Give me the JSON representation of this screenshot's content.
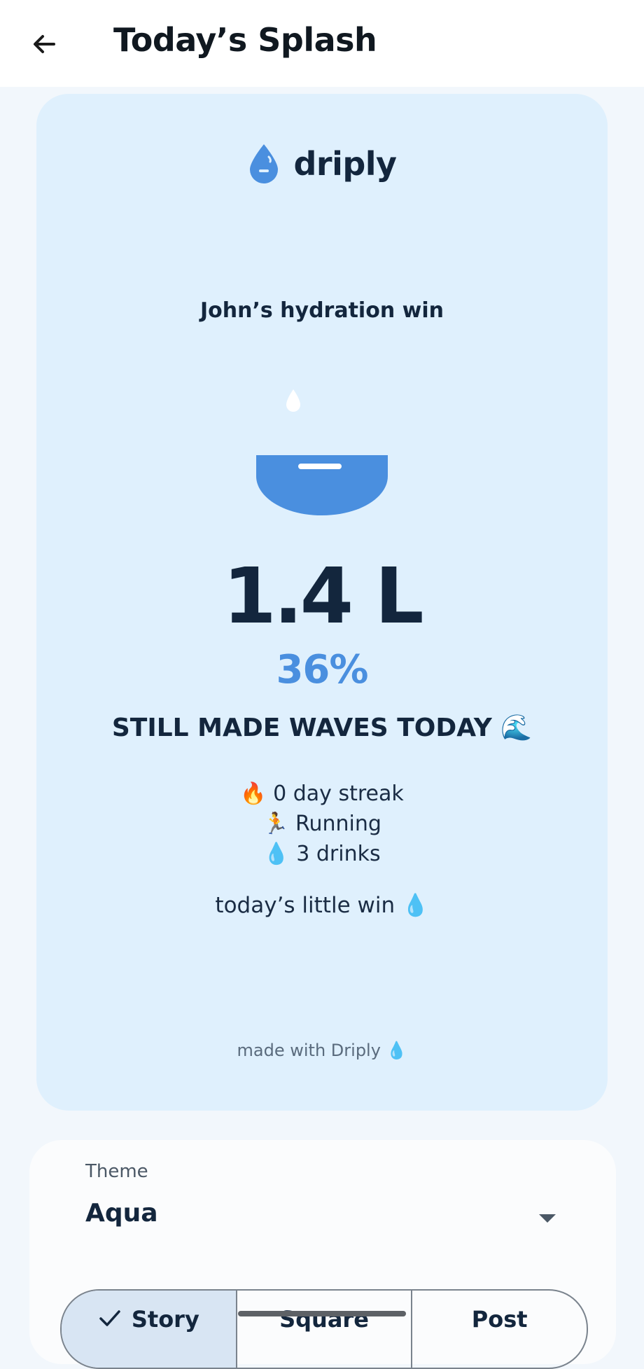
{
  "appbar": {
    "title": "Today’s Splash",
    "back_icon": "arrow-back-icon"
  },
  "card": {
    "brand": {
      "name": "driply",
      "logo_icon": "water-drop-logo-icon"
    },
    "headline_user": "John’s hydration win",
    "amount": "1.4 L",
    "percent": "36%",
    "message": "STILL MADE WAVES TODAY 🌊",
    "stats": [
      {
        "text": "🔥 0 day streak"
      },
      {
        "text": "🏃 Running"
      },
      {
        "text": "💧 3 drinks"
      }
    ],
    "little_win": "today’s little win 💧",
    "footer": "made with Driply 💧",
    "progress_fraction": 0.36,
    "colors": {
      "card_bg": "#dff0fd",
      "accent": "#4a8fdf",
      "text": "#13263d"
    }
  },
  "settings": {
    "theme_label": "Theme",
    "theme_value": "Aqua",
    "formats": [
      {
        "label": "Story",
        "selected": true
      },
      {
        "label": "Square",
        "selected": false
      },
      {
        "label": "Post",
        "selected": false
      }
    ]
  }
}
